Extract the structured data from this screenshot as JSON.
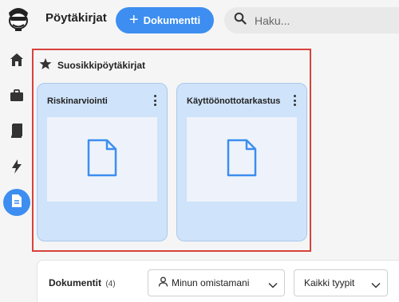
{
  "header": {
    "app_title": "Pöytäkirjat",
    "new_document_label": "Dokumentti",
    "search_placeholder": "Haku..."
  },
  "sidebar": {
    "items": [
      {
        "icon": "home-icon",
        "active": false
      },
      {
        "icon": "briefcase-icon",
        "active": false
      },
      {
        "icon": "book-icon",
        "active": false
      },
      {
        "icon": "lightning-icon",
        "active": false
      },
      {
        "icon": "document-icon",
        "active": true
      }
    ]
  },
  "favorites": {
    "title": "Suosikkipöytäkirjat",
    "cards": [
      {
        "title": "Riskinarviointi"
      },
      {
        "title": "Käyttöönottotarkastus"
      }
    ]
  },
  "documents": {
    "title": "Dokumentit",
    "count": "(4)",
    "owner_filter": "Minun omistamani",
    "type_filter": "Kaikki tyypit"
  },
  "colors": {
    "accent": "#3d8ef0",
    "card_bg": "#cfe3fa",
    "highlight_border": "#d8413a"
  }
}
